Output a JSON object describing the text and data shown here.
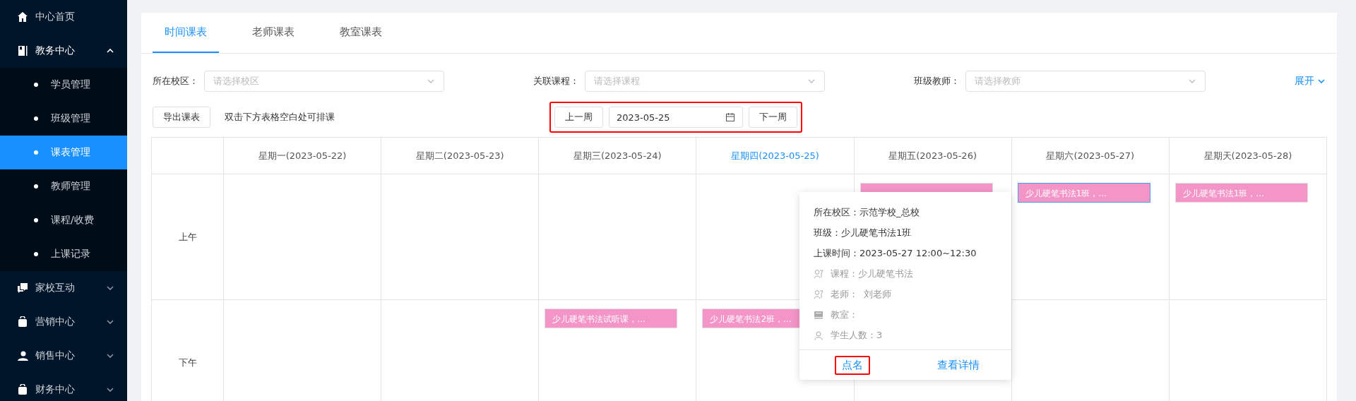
{
  "sidebar": {
    "items": [
      {
        "label": "中心首页"
      },
      {
        "label": "教务中心",
        "expanded": true,
        "children": [
          {
            "label": "学员管理",
            "selected": false
          },
          {
            "label": "班级管理",
            "selected": false
          },
          {
            "label": "课表管理",
            "selected": true
          },
          {
            "label": "教师管理",
            "selected": false
          },
          {
            "label": "课程/收费",
            "selected": false
          },
          {
            "label": "上课记录",
            "selected": false
          }
        ]
      },
      {
        "label": "家校互动",
        "expanded": false
      },
      {
        "label": "营销中心",
        "expanded": false
      },
      {
        "label": "销售中心",
        "expanded": false
      },
      {
        "label": "财务中心",
        "expanded": false
      }
    ]
  },
  "tabs": [
    {
      "label": "时间课表",
      "selected": true
    },
    {
      "label": "老师课表",
      "selected": false
    },
    {
      "label": "教室课表",
      "selected": false
    }
  ],
  "filters": [
    {
      "label": "所在校区：",
      "placeholder": "请选择校区"
    },
    {
      "label": "关联课程：",
      "placeholder": "请选择课程"
    },
    {
      "label": "班级教师：",
      "placeholder": "请选择教师"
    }
  ],
  "expand_link": "展开",
  "toolbar": {
    "export_button": "导出课表",
    "hint": "双击下方表格空白处可排课"
  },
  "week_nav": {
    "highlighted": true,
    "prev": "上一周",
    "date": "2023-05-25",
    "next": "下一周"
  },
  "table": {
    "days": [
      {
        "label": "星期一(2023-05-22)",
        "today": false
      },
      {
        "label": "星期二(2023-05-23)",
        "today": false
      },
      {
        "label": "星期三(2023-05-24)",
        "today": false
      },
      {
        "label": "星期四(2023-05-25)",
        "today": true
      },
      {
        "label": "星期五(2023-05-26)",
        "today": false
      },
      {
        "label": "星期六(2023-05-27)",
        "today": false
      },
      {
        "label": "星期天(2023-05-28)",
        "today": false
      }
    ],
    "rows": [
      {
        "label": "上午",
        "cells": [
          null,
          null,
          null,
          null,
          {
            "event": {
              "selected": false
            }
          },
          {
            "event": {
              "label": "少儿硬笔书法1班，...",
              "selected": true
            }
          },
          {
            "event": {
              "label": "少儿硬笔书法1班，...",
              "selected": false
            }
          }
        ]
      },
      {
        "label": "下午",
        "cells": [
          null,
          null,
          {
            "event": {
              "label": "少儿硬笔书法试听课，...",
              "selected": false
            }
          },
          {
            "event": {
              "label": "少儿硬笔书法2班，...",
              "selected": false
            }
          },
          null,
          null,
          null
        ]
      }
    ]
  },
  "popup": {
    "lines": [
      {
        "kind": "plain",
        "text": "所在校区：示范学校_总校"
      },
      {
        "kind": "plain",
        "text": "班级：少儿硬笔书法1班"
      },
      {
        "kind": "plain",
        "text": "上课时间：2023-05-27 12:00~12:30"
      },
      {
        "kind": "icon",
        "text": "课程：少儿硬笔书法"
      },
      {
        "kind": "icon",
        "text": "老师：  刘老师"
      },
      {
        "kind": "icon",
        "text": "教室："
      },
      {
        "kind": "icon",
        "text": "学生人数：3"
      }
    ],
    "actions": [
      {
        "label": "点名",
        "highlighted": true
      },
      {
        "label": "查看详情",
        "highlighted": false
      }
    ]
  }
}
